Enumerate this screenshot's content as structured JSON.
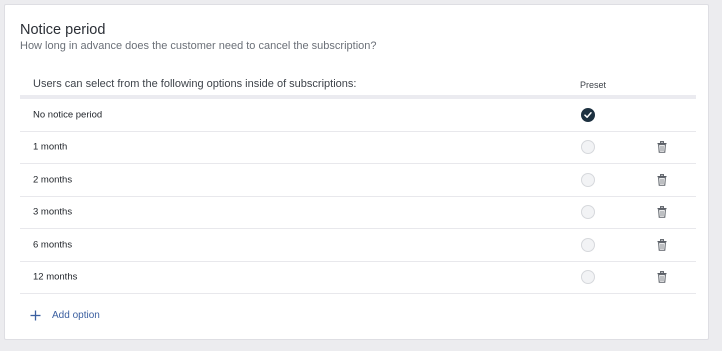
{
  "section": {
    "title": "Notice period",
    "subtitle": "How long in advance does the customer need to cancel the subscription?"
  },
  "table": {
    "header_label": "Users can select from the following options inside of subscriptions:",
    "header_preset": "Preset",
    "rows": [
      {
        "label": "No notice period",
        "preset": true,
        "deletable": false
      },
      {
        "label": "1 month",
        "preset": false,
        "deletable": true
      },
      {
        "label": "2 months",
        "preset": false,
        "deletable": true
      },
      {
        "label": "3 months",
        "preset": false,
        "deletable": true
      },
      {
        "label": "6 months",
        "preset": false,
        "deletable": true
      },
      {
        "label": "12 months",
        "preset": false,
        "deletable": true
      }
    ]
  },
  "actions": {
    "add_option_label": "Add option"
  },
  "icons": {
    "check": "check-icon",
    "trash": "trash-icon",
    "plus": "plus-icon"
  },
  "colors": {
    "accent_link": "#3b5fa0",
    "preset_selected": "#1d3140"
  }
}
